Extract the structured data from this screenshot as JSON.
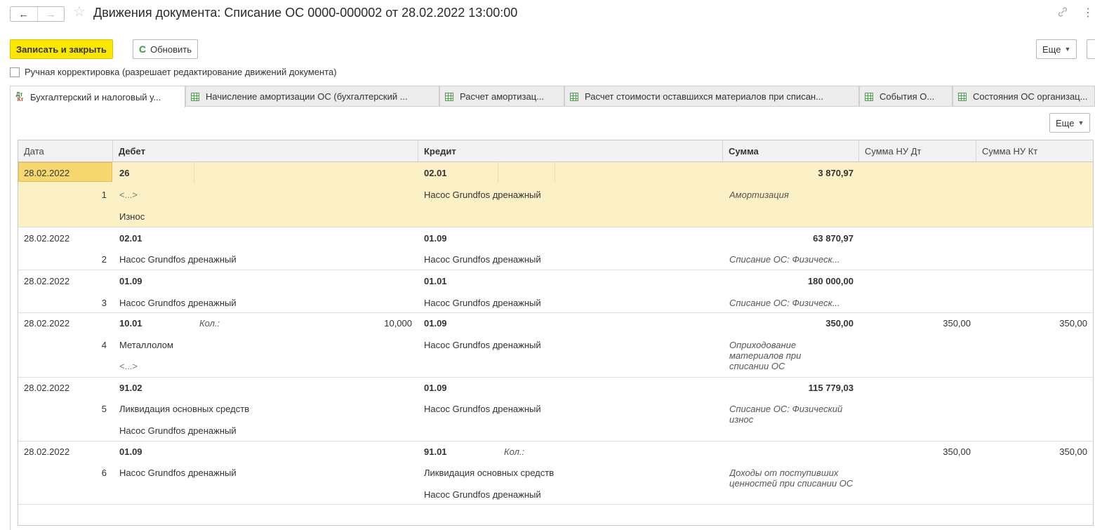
{
  "header": {
    "title": "Движения документа: Списание ОС 0000-000002 от 28.02.2022 13:00:00",
    "back": "←",
    "forward": "→",
    "star": "☆",
    "link_icon": "🔗",
    "kebab": "⋮"
  },
  "toolbar": {
    "save_close": "Записать и закрыть",
    "refresh": "Обновить",
    "refresh_icon": "C",
    "more": "Еще",
    "caret": "▼"
  },
  "manual_edit": {
    "label": "Ручная корректировка (разрешает редактирование движений документа)",
    "checked": false
  },
  "tabs": [
    {
      "label": "Бухгалтерский и налоговый у...",
      "active": true,
      "icon": "dt-kt-icon"
    },
    {
      "label": "Начисление амортизации ОС (бухгалтерский ...",
      "active": false,
      "icon": "register-icon"
    },
    {
      "label": "Расчет амортизац...",
      "active": false,
      "icon": "register-icon"
    },
    {
      "label": "Расчет стоимости оставшихся материалов при списан...",
      "active": false,
      "icon": "register-icon"
    },
    {
      "label": "События О...",
      "active": false,
      "icon": "register-icon"
    },
    {
      "label": "Состояния ОС организац...",
      "active": false,
      "icon": "register-icon"
    }
  ],
  "tab_icon": {
    "dt": "Дт",
    "kt": "Кт"
  },
  "panel": {
    "more": "Еще"
  },
  "table": {
    "columns": [
      "Дата",
      "Дебет",
      "Кредит",
      "Сумма",
      "Сумма НУ Дт",
      "Сумма НУ Кт"
    ],
    "rows": [
      {
        "date": "28.02.2022",
        "n": "1",
        "debit": "26",
        "debit_1": "<...>",
        "debit_2": "Износ",
        "credit": "02.01",
        "credit_1": "Насос Grundfos дренажный",
        "credit_2": "",
        "sum": "3 870,97",
        "content": "Амортизация",
        "nu_dt": "",
        "nu_kt": ""
      },
      {
        "date": "28.02.2022",
        "n": "2",
        "debit": "02.01",
        "debit_1": "Насос Grundfos дренажный",
        "debit_2": "",
        "credit": "01.09",
        "credit_1": "Насос Grundfos дренажный",
        "credit_2": "",
        "sum": "63 870,97",
        "content": "Списание ОС: Физическ...",
        "nu_dt": "",
        "nu_kt": ""
      },
      {
        "date": "28.02.2022",
        "n": "3",
        "debit": "01.09",
        "debit_1": "Насос Grundfos дренажный",
        "debit_2": "",
        "credit": "01.01",
        "credit_1": "Насос Grundfos дренажный",
        "credit_2": "",
        "sum": "180 000,00",
        "content": "Списание ОС: Физическ...",
        "nu_dt": "",
        "nu_kt": ""
      },
      {
        "date": "28.02.2022",
        "n": "4",
        "debit": "10.01",
        "debit_qty_label": "Кол.:",
        "debit_qty": "10,000",
        "debit_1": "Металлолом",
        "debit_2": "<...>",
        "credit": "01.09",
        "credit_1": "Насос Grundfos дренажный",
        "credit_2": "",
        "sum": "350,00",
        "content": "Оприходование материалов при списании ОС",
        "nu_dt": "350,00",
        "nu_kt": "350,00"
      },
      {
        "date": "28.02.2022",
        "n": "5",
        "debit": "91.02",
        "debit_1": "Ликвидация основных средств",
        "debit_2": "Насос Grundfos дренажный",
        "credit": "01.09",
        "credit_1": "Насос Grundfos дренажный",
        "credit_2": "",
        "sum": "115 779,03",
        "content": "Списание ОС: Физический износ",
        "nu_dt": "",
        "nu_kt": ""
      },
      {
        "date": "28.02.2022",
        "n": "6",
        "debit": "01.09",
        "debit_1": "Насос Grundfos дренажный",
        "debit_2": "",
        "credit": "91.01",
        "credit_qty_label": "Кол.:",
        "credit_1": "Ликвидация основных средств",
        "credit_2": "Насос Grundfos дренажный",
        "sum": "",
        "content": "Доходы от поступивших ценностей при списании ОС",
        "nu_dt": "350,00",
        "nu_kt": "350,00"
      }
    ]
  },
  "colors": {
    "primary": "#fce700",
    "selected_row": "#fbf0c6",
    "selected_cell": "#f6d86f",
    "tab_bg": "#ececec"
  }
}
